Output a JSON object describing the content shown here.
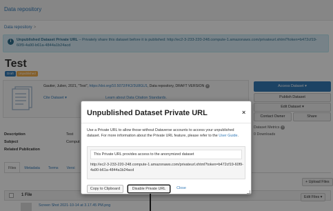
{
  "page": {
    "brand": "Data repository",
    "breadcrumb": "Data repository",
    "breadcrumb_sep": ">",
    "alert_title": "Unpublished Dataset Private URL",
    "alert_text": " – Privately share this dataset before it is published: http://ec2-3-233-220-248.compute-1.amazonaws.com/privateurl.xhtml?token=b472cf19-60f9-4a90-b61a-4844a1b24acd",
    "dataset_title": "Test",
    "badge_draft": "Draft",
    "badge_unpublished": "Unpublished",
    "citation_prefix": "Gautier, Julien, 2021, \"Test\", ",
    "citation_doi": "https://doi.org/10.5072/FK2/3U8GU1",
    "citation_suffix": ", Data repository, DRAFT VERSION",
    "cite_dataset": "Cite Dataset ▾",
    "learn_more": "Learn about Data Citation Standards."
  },
  "sidebar": {
    "access_dataset": "Access Dataset ▾",
    "publish_dataset": "Publish Dataset",
    "edit_dataset": "Edit Dataset ▾",
    "contact_owner": "Contact Owner",
    "share": "Share",
    "metrics_label": "Dataset Metrics",
    "downloads": "0 Downloads"
  },
  "metadata": {
    "description_label": "Description",
    "subject_label": "Subject",
    "related_label": "Related Publication",
    "description_value": "Test",
    "subject_value": "Comput"
  },
  "tabs": [
    "Files",
    "Metadata",
    "Terms",
    "Versi"
  ],
  "files": {
    "upload": "+ Upload Files",
    "count": "1 File",
    "edit_files": "Edit Files ▾",
    "file_name": "Screen Shot 2021-10-14 at 3.17.45 PM.png"
  },
  "modal": {
    "title": "Unpublished Dataset Private URL",
    "close": "×",
    "desc_text": "Use a Private URL to allow those without Dataverse accounts to access your unpublished dataset. For more information about the Private URL feature, please refer to the ",
    "desc_link": "User Guide",
    "desc_end": ".",
    "box_heading": "This Private URL provides access to the anonymized dataset",
    "url": "http://ec2-3-233-220-248.compute-1.amazonaws.com/privateurl.xhtml?token=b472cf19-60f9-4a90-b61a-4844a1b24acd",
    "copy_button": "Copy to Clipboard",
    "disable_button": "Disable Private URL",
    "close_button": "Close"
  }
}
